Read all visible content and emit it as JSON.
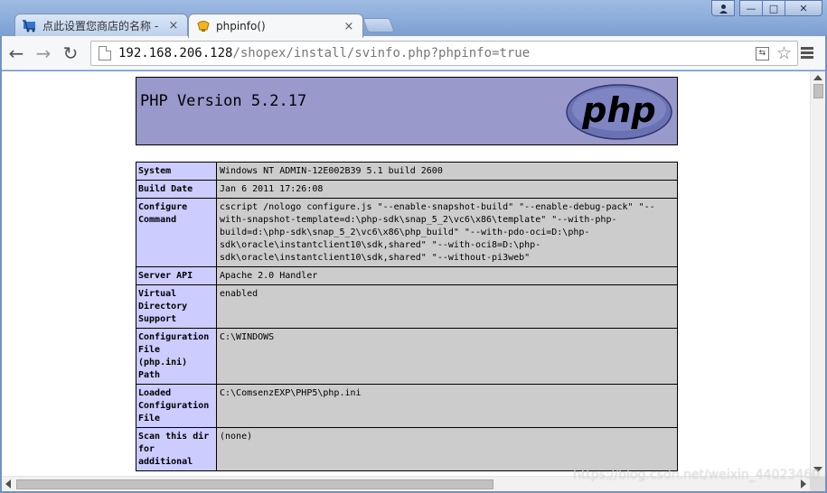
{
  "browser": {
    "tabs": [
      {
        "label": "点此设置您商店的名称 -",
        "active": false,
        "icon": "cart-icon"
      },
      {
        "label": "phpinfo()",
        "active": true,
        "icon": "php-elephant-icon"
      }
    ],
    "url_host": "192.168.206.128",
    "url_path": "/shopex/install/svinfo.php?phpinfo=true",
    "close_glyph": "×",
    "nav_icons": {
      "back": "←",
      "forward": "→",
      "reload": "↻"
    },
    "window_controls": {
      "min": "—",
      "max": "□",
      "close": "✕",
      "user": "👤"
    },
    "translate_glyph": "⇆",
    "star_glyph": "☆"
  },
  "php": {
    "version_title": "PHP Version 5.2.17",
    "logo_text": "php",
    "rows": [
      {
        "key": "System",
        "value": "Windows NT ADMIN-12E002B39 5.1 build 2600"
      },
      {
        "key": "Build Date",
        "value": "Jan 6 2011 17:26:08"
      },
      {
        "key": "Configure Command",
        "value": "cscript /nologo configure.js \"--enable-snapshot-build\" \"--enable-debug-pack\" \"--with-snapshot-template=d:\\php-sdk\\snap_5_2\\vc6\\x86\\template\" \"--with-php-build=d:\\php-sdk\\snap_5_2\\vc6\\x86\\php_build\" \"--with-pdo-oci=D:\\php-sdk\\oracle\\instantclient10\\sdk,shared\" \"--with-oci8=D:\\php-sdk\\oracle\\instantclient10\\sdk,shared\" \"--without-pi3web\""
      },
      {
        "key": "Server API",
        "value": "Apache 2.0 Handler"
      },
      {
        "key": "Virtual Directory Support",
        "value": "enabled"
      },
      {
        "key": "Configuration File (php.ini) Path",
        "value": "C:\\WINDOWS"
      },
      {
        "key": "Loaded Configuration File",
        "value": "C:\\ComsenzEXP\\PHP5\\php.ini"
      },
      {
        "key": "Scan this dir for additional",
        "value": "(none)"
      }
    ]
  },
  "watermark": "https://blog.csdn.net/weixin_44023460",
  "colors": {
    "header_bg": "#9999cc",
    "key_bg": "#ccccff",
    "value_bg": "#cccccc",
    "frame": "#7b9fd2"
  }
}
